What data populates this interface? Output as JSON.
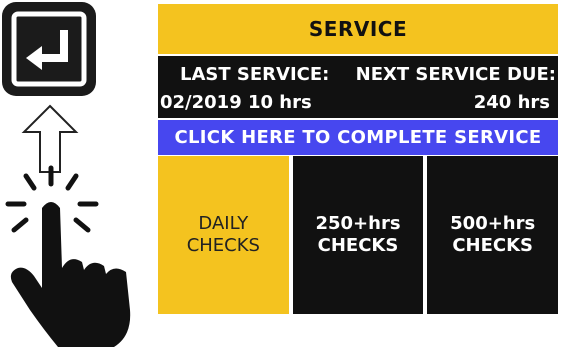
{
  "service": {
    "title": "SERVICE",
    "last_service_label": "LAST SERVICE:",
    "next_service_label": "NEXT SERVICE DUE:",
    "last_service_value": "02/2019  10 hrs",
    "next_service_value": "240 hrs",
    "complete_button": "CLICK HERE TO COMPLETE SERVICE",
    "checks": [
      {
        "label": "DAILY\nCHECKS"
      },
      {
        "label": "250+hrs\nCHECKS"
      },
      {
        "label": "500+hrs\nCHECKS"
      }
    ]
  },
  "colors": {
    "yellow": "#f4c31f",
    "black": "#111111",
    "blue": "#4747ef"
  },
  "icons": [
    "enter-key-icon",
    "up-arrow-icon",
    "pointing-hand-icon"
  ]
}
